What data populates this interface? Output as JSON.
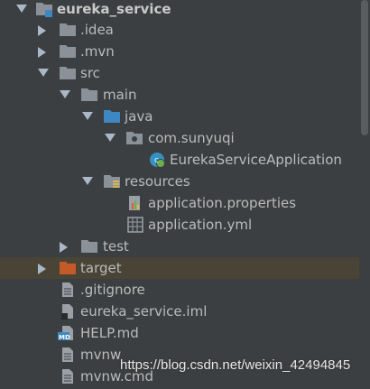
{
  "tree": {
    "items": [
      {
        "label": "eureka_service",
        "icon": "module-folder-icon",
        "expanded": true,
        "bold": true
      },
      {
        "label": ".idea",
        "icon": "folder-icon",
        "expanded": false
      },
      {
        "label": ".mvn",
        "icon": "folder-icon",
        "expanded": false
      },
      {
        "label": "src",
        "icon": "folder-icon",
        "expanded": true
      },
      {
        "label": "main",
        "icon": "folder-icon",
        "expanded": true
      },
      {
        "label": "java",
        "icon": "source-root-folder-icon",
        "expanded": true
      },
      {
        "label": "com.sunyuqi",
        "icon": "package-icon",
        "expanded": true
      },
      {
        "label": "EurekaServiceApplication",
        "icon": "spring-boot-class-icon"
      },
      {
        "label": "resources",
        "icon": "resources-folder-icon",
        "expanded": true
      },
      {
        "label": "application.properties",
        "icon": "properties-file-icon"
      },
      {
        "label": "application.yml",
        "icon": "yml-file-icon"
      },
      {
        "label": "test",
        "icon": "folder-icon",
        "expanded": false
      },
      {
        "label": "target",
        "icon": "excluded-folder-icon",
        "expanded": false,
        "highlighted": true
      },
      {
        "label": ".gitignore",
        "icon": "text-file-icon"
      },
      {
        "label": "eureka_service.iml",
        "icon": "iml-file-icon"
      },
      {
        "label": "HELP.md",
        "icon": "markdown-file-icon"
      },
      {
        "label": "mvnw",
        "icon": "text-file-icon"
      },
      {
        "label": "mvnw.cmd",
        "icon": "text-file-icon"
      }
    ]
  },
  "watermark": "https://blog.csdn.net/weixin_42494845",
  "colors": {
    "background": "#3c3f41",
    "text": "#bbbbbb",
    "folder": "#8a9199",
    "source_root": "#3d87c2",
    "excluded_folder": "#c45a27",
    "highlight_row": "#4a4437"
  }
}
